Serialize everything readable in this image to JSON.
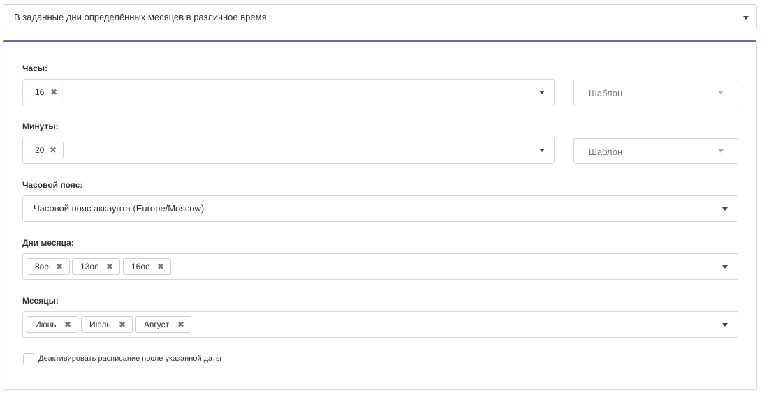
{
  "schedule_type": {
    "value": "В заданные дни определённых месяцев в различное время"
  },
  "hours": {
    "label": "Часы:",
    "chips": [
      "16"
    ],
    "template_placeholder": "Шаблон"
  },
  "minutes": {
    "label": "Минуты:",
    "chips": [
      "20"
    ],
    "template_placeholder": "Шаблон"
  },
  "timezone": {
    "label": "Часовой пояс:",
    "value": "Часовой пояс аккаунта (Europe/Moscow)"
  },
  "days": {
    "label": "Дни месяца:",
    "chips": [
      "8ое",
      "13ое",
      "16ое"
    ]
  },
  "months": {
    "label": "Месяцы:",
    "chips": [
      "Июнь",
      "Июль",
      "Август"
    ]
  },
  "deactivate": {
    "label": "Деактивировать расписание после указанной даты",
    "checked": false
  },
  "icons": {
    "remove": "✖"
  },
  "colors": {
    "accent": "#5c6bc0",
    "border": "#d6d6d6"
  }
}
